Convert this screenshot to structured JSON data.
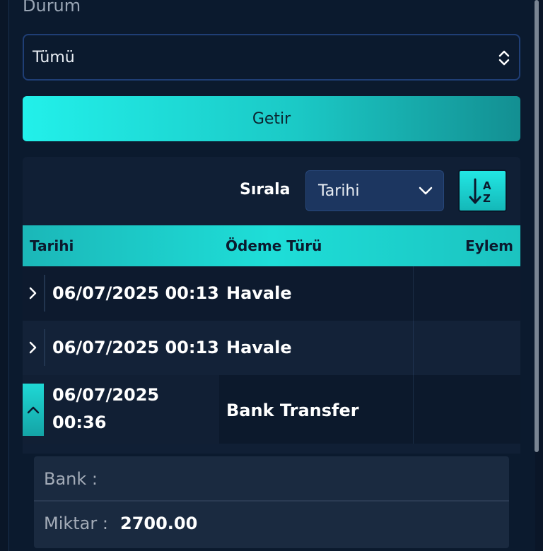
{
  "filters": {
    "status_label": "Durum",
    "status_value": "Tümü",
    "fetch_button": "Getir"
  },
  "sort": {
    "label": "Sırala",
    "value": "Tarihi",
    "order_icon": "sort-a-z-icon"
  },
  "table": {
    "columns": [
      "Tarihi",
      "Ödeme Türü",
      "Eylem"
    ],
    "rows": [
      {
        "date": "06/07/2025 00:13",
        "type": "Havale",
        "expanded": false
      },
      {
        "date": "06/07/2025 00:13",
        "type": "Havale",
        "expanded": false
      },
      {
        "date_line1": "06/07/2025",
        "date_line2": "00:36",
        "type": "Bank Transfer",
        "expanded": true
      }
    ]
  },
  "detail": {
    "bank_label": "Bank :",
    "bank_value": "",
    "amount_label": "Miktar :",
    "amount_value": "2700.00"
  },
  "colors": {
    "background": "#0a1628",
    "accent": "#1eded8",
    "select_border": "#1f3e75"
  }
}
